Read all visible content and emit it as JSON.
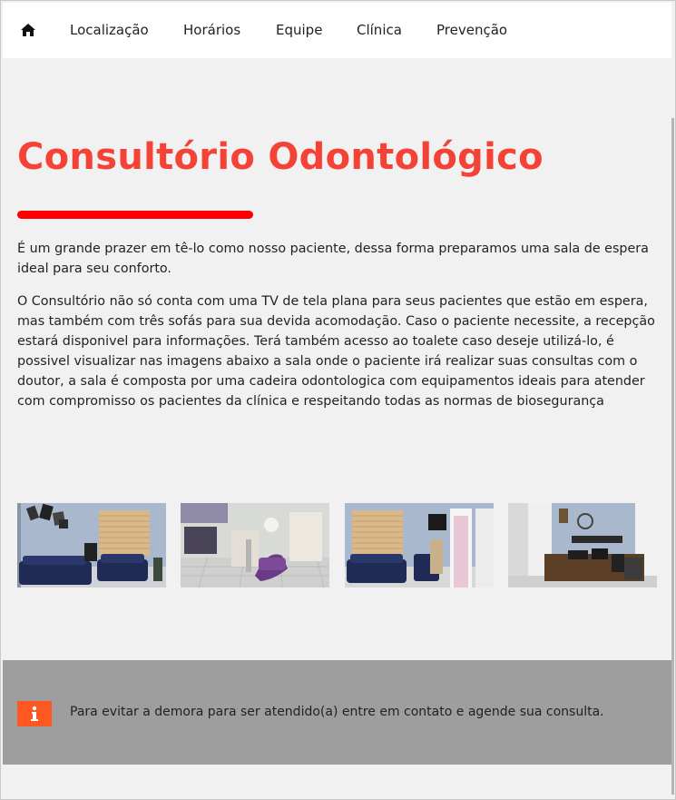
{
  "nav": {
    "home_icon": "home-icon",
    "items": [
      {
        "label": "Localização"
      },
      {
        "label": "Horários"
      },
      {
        "label": "Equipe"
      },
      {
        "label": "Clínica"
      },
      {
        "label": "Prevenção"
      }
    ]
  },
  "main": {
    "title": "Consultório Odontológico",
    "accent_color": "#f44336",
    "underline_color": "#ff0000",
    "paragraphs": [
      "É um grande prazer em tê-lo como nosso paciente, dessa forma preparamos uma sala de espera ideal para seu conforto.",
      "O Consultório não só conta com uma TV de tela plana para seus pacientes que estão em espera, mas também com três sofás para sua devida acomodação. Caso o paciente necessite, a recepção estará disponivel para informações. Terá também acesso ao toalete caso deseje utilizá-lo, é possivel visualizar nas imagens abaixo a sala onde o paciente irá realizar suas consultas com o doutor, a sala é composta por uma cadeira odontologica com equipamentos ideais para atender com compromisso os pacientes da clínica e respeitando todas as normas de biosegurança"
    ]
  },
  "gallery": {
    "images": [
      "waiting-room-sofas",
      "dental-chair-room",
      "waiting-room-tv",
      "office-desk"
    ]
  },
  "footer": {
    "icon": "info-icon",
    "icon_color": "#ff5722",
    "message": "Para evitar a demora para ser atendido(a) entre em contato e agende sua consulta."
  }
}
